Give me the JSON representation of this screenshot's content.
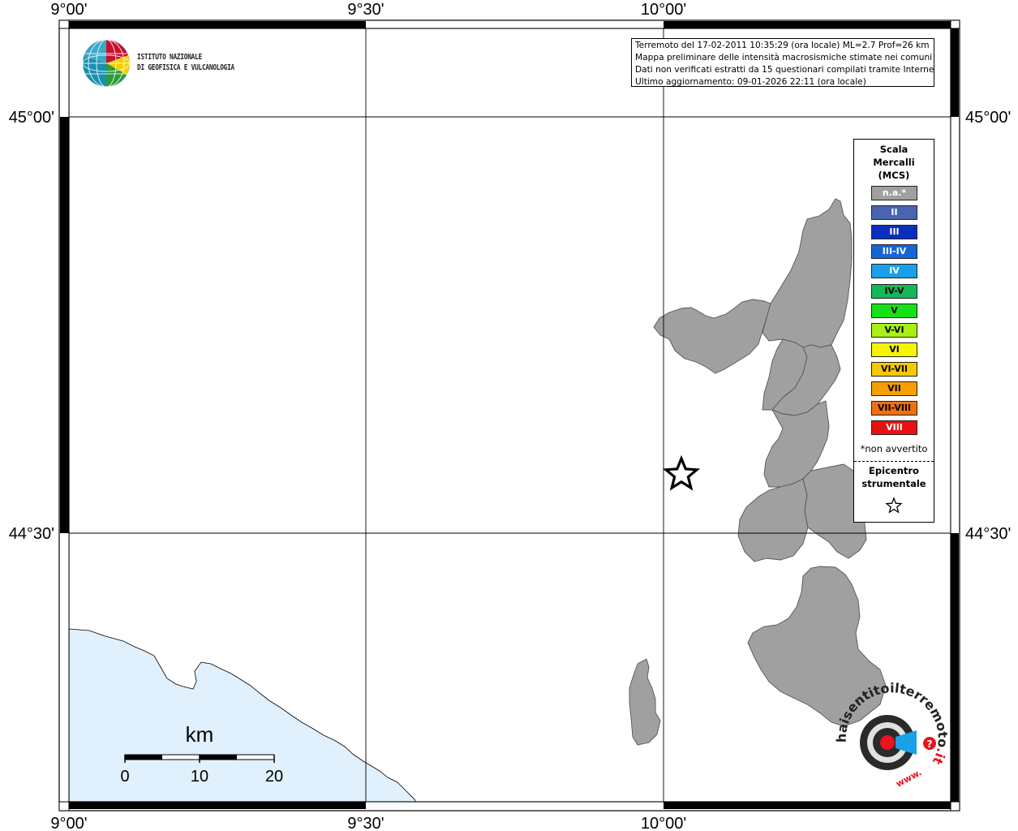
{
  "map": {
    "lon_labels": [
      "9°00'",
      "9°30'",
      "10°00'"
    ],
    "lat_labels": [
      "45°00'",
      "44°30'"
    ]
  },
  "institute": {
    "line1": "ISTITUTO NAZIONALE",
    "line2": "DI GEOFISICA E VULCANOLOGIA"
  },
  "info": {
    "line1": "Terremoto del 17-02-2011 10:35:29 (ora locale) ML=2.7 Prof=26 km",
    "line2": "Mappa preliminare delle intensità macrosismiche stimate nei comuni",
    "line3": "Dati non verificati estratti da 15 questionari compilati tramite Internet.",
    "line4": "Ultimo aggiornamento: 09-01-2026 22:11 (ora locale)"
  },
  "legend": {
    "title_line1": "Scala",
    "title_line2": "Mercalli",
    "title_line3": "(MCS)",
    "items": [
      {
        "label": "n.a.*",
        "color": "#a0a0a0",
        "text_color": "#ffffff"
      },
      {
        "label": "II",
        "color": "#4a64b0",
        "text_color": "#ffffff"
      },
      {
        "label": "III",
        "color": "#0a2fbe",
        "text_color": "#ffffff"
      },
      {
        "label": "III-IV",
        "color": "#1565d8",
        "text_color": "#ffffff"
      },
      {
        "label": "IV",
        "color": "#1aa0e8",
        "text_color": "#ffffff"
      },
      {
        "label": "IV-V",
        "color": "#14b85a",
        "text_color": "#000000"
      },
      {
        "label": "V",
        "color": "#16e016",
        "text_color": "#000000"
      },
      {
        "label": "V-VI",
        "color": "#a8f014",
        "text_color": "#000000"
      },
      {
        "label": "VI",
        "color": "#f5f500",
        "text_color": "#000000"
      },
      {
        "label": "VI-VII",
        "color": "#f5c800",
        "text_color": "#000000"
      },
      {
        "label": "VII",
        "color": "#f5a000",
        "text_color": "#000000"
      },
      {
        "label": "VII-VIII",
        "color": "#f07010",
        "text_color": "#000000"
      },
      {
        "label": "VIII",
        "color": "#e81010",
        "text_color": "#ffffff"
      }
    ],
    "note": "*non avvertito",
    "epicenter_line1": "Epicentro",
    "epicenter_line2": "strumentale"
  },
  "scale_bar": {
    "unit": "km",
    "ticks": [
      "0",
      "10",
      "20"
    ]
  },
  "badge": {
    "text_main": "haisentitoilterremoto",
    "text_it": ".it",
    "text_www": "www.",
    "question": "?"
  },
  "colors": {
    "sea": "#e0f0fc",
    "municipality": "#a0a0a0",
    "municipality_border": "#555555"
  }
}
